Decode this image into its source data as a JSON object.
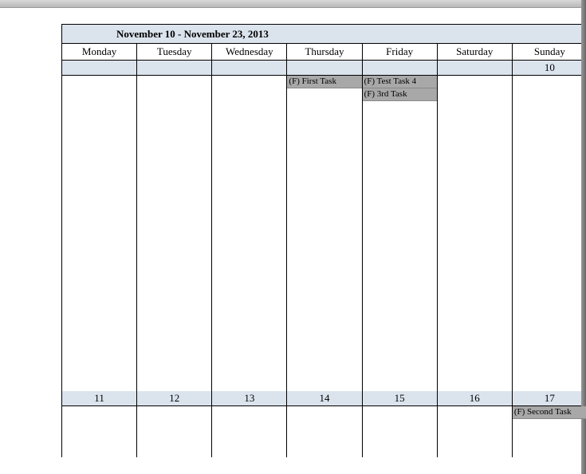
{
  "calendar": {
    "title": "November 10 - November 23, 2013",
    "dayHeaders": [
      "Monday",
      "Tuesday",
      "Wednesday",
      "Thursday",
      "Friday",
      "Saturday",
      "Sunday"
    ],
    "weeks": [
      {
        "dates": [
          "",
          "",
          "",
          "",
          "",
          "",
          "10"
        ],
        "tasks": {
          "3": [
            "(F) First Task"
          ],
          "4": [
            "(F) Test Task 4",
            "(F) 3rd Task"
          ]
        }
      },
      {
        "dates": [
          "11",
          "12",
          "13",
          "14",
          "15",
          "16",
          "17"
        ],
        "tasks": {
          "6": [
            "(F) Second Task"
          ]
        }
      }
    ]
  }
}
